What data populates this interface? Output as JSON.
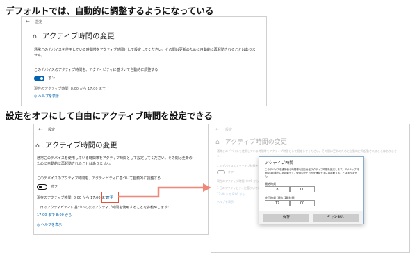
{
  "headings": {
    "top": "デフォルトでは、自動的に調整するようになっている",
    "bottom": "設定をオフにして自由にアクティブ時間を設定できる"
  },
  "win1": {
    "app_title": "設定",
    "page_title": "アクティブ時間の変更",
    "description": "通常このデバイスを使用している時間帯をアクティブ時間として設定してください。その間は更新のために自動的に再起動されることはありません。",
    "auto_label": "このデバイスのアクティブ時間を、アクティビティに基づいて自動的に調整する",
    "toggle_state": "オン",
    "current_hours": "現在のアクティブ時間: 8:00 から 17:00 まで",
    "help": "ヘルプを表示"
  },
  "win2": {
    "app_title": "設定",
    "page_title": "アクティブ時間の変更",
    "description": "通常このデバイスを使用している時間帯をアクティブ時間として設定してください。その間は更新のために自動的に再起動されることはありません。",
    "auto_label": "このデバイスのアクティブ時間を、アクティビティに基づいて自動的に調整する",
    "toggle_state": "オフ",
    "current_hours": "現在のアクティブ時間: 8:00 から 17:00 まで",
    "change_link": "変更",
    "recommend": "1 日のアクティビティに基づいて次のアクティブ時間を使用することをお勧めします:",
    "recommend_value": "17:00 まで 8:00 から",
    "help": "ヘルプを表示"
  },
  "win3": {
    "app_title": "設定",
    "page_title": "アクティブ時間の変更",
    "description": "通常このデバイスを使用している時間帯をアクティブ時間として設定してください。その間は更新のために自動的に再起動されることはありません。",
    "auto_label": "このデバイスのアクティブ時間を、アクティビティに基づいて自動的に調整する",
    "toggle_state": "オフ",
    "current_hours": "現在のアクティブ時間: 8:00 から 17:00 まで",
    "recommend": "1 日のアクティビティに基づいて次のアクティブ時間を使用することをお勧めします:",
    "recommend_value": "17:00 まで 8:00 から",
    "help": "ヘルプを表示",
    "dialog": {
      "title": "アクティブ時間",
      "description": "このデバイスを通常使う時間帯を知らせるアクティブ時間を設定します。アクティブ時間中は自動的に再起動せず、使用中かどうかを確認せずに再起動することはありません。",
      "start_label": "開始時刻",
      "start_hour": "8",
      "start_min": "00",
      "end_label": "終了時刻 (最大 18 時間)",
      "end_hour": "17",
      "end_min": "00",
      "save": "保存",
      "cancel": "キャンセル"
    }
  },
  "colors": {
    "accent": "#0063b1",
    "highlight": "#e8503a"
  }
}
